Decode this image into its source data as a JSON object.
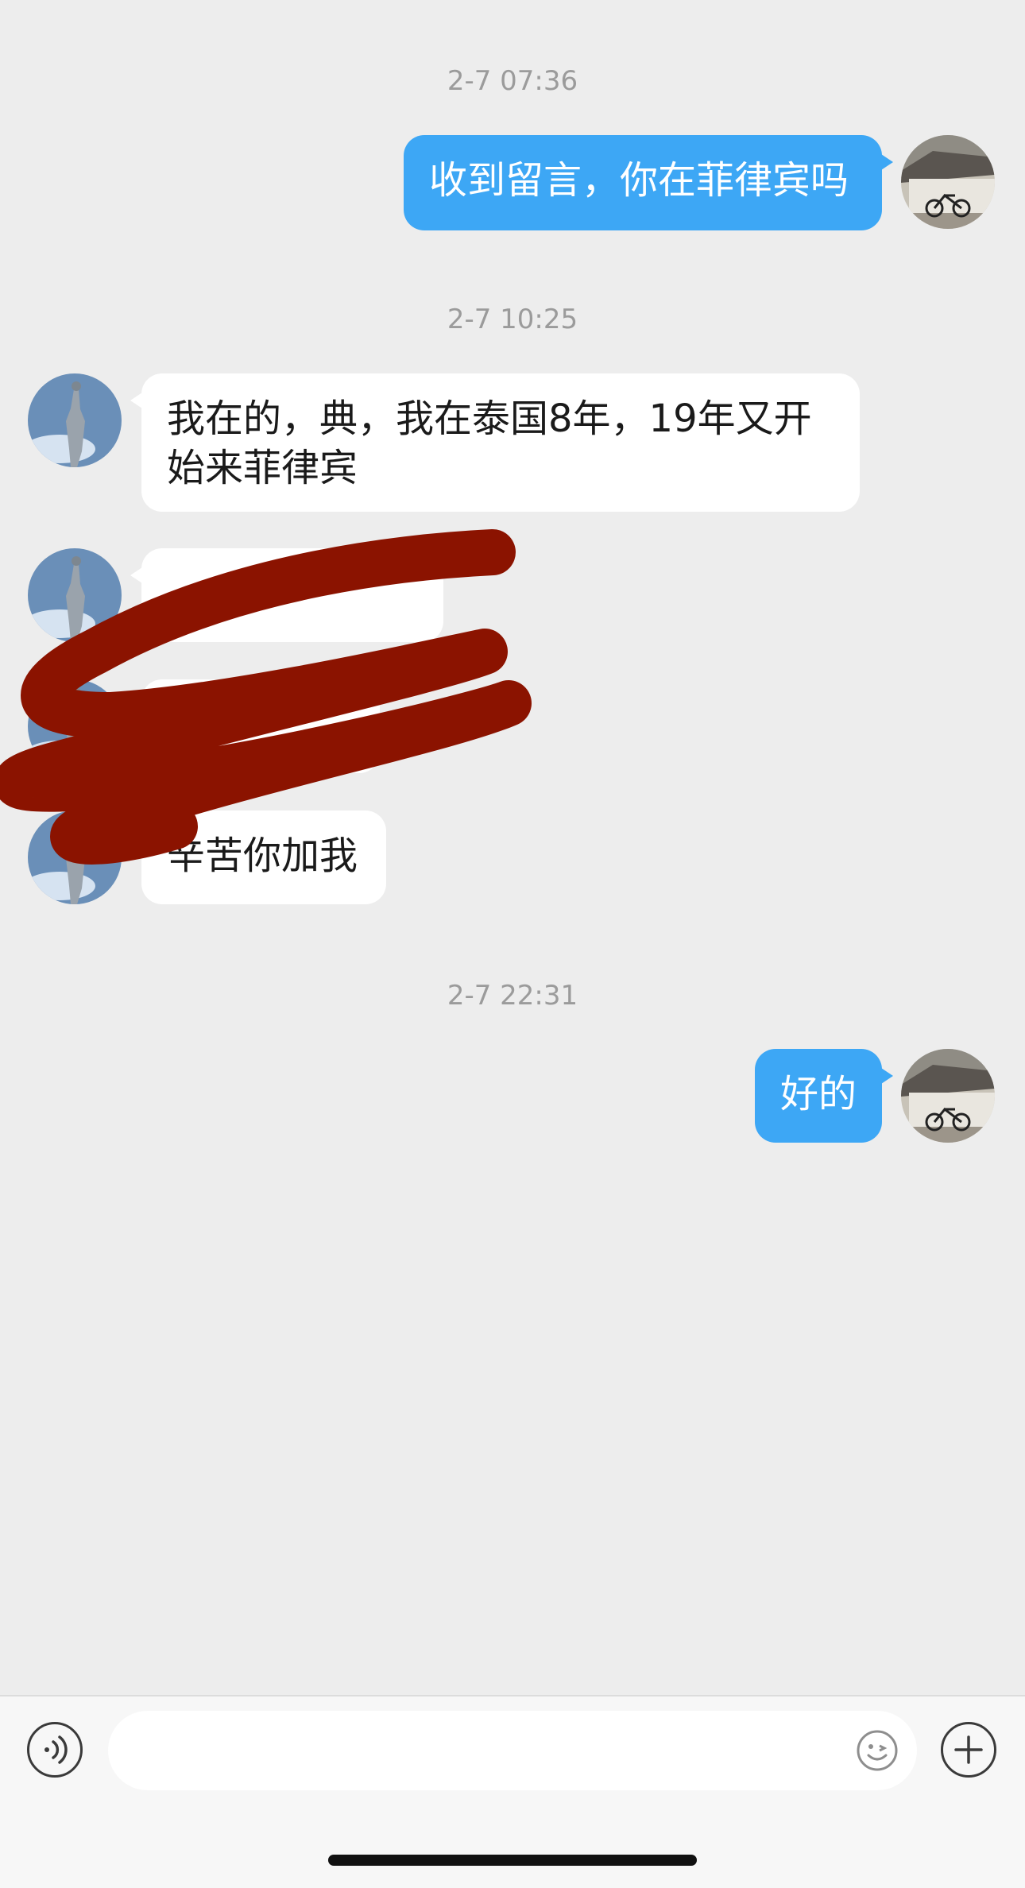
{
  "messages": [
    {
      "timestamp": "2-7 07:36",
      "direction": "outgoing",
      "text": "收到留言，你在菲律宾吗"
    },
    {
      "timestamp": "2-7 10:25",
      "direction": "incoming",
      "text": "我在的，典，我在泰国8年，19年又开始来菲律宾"
    },
    {
      "direction": "incoming",
      "text": "",
      "redacted": true
    },
    {
      "direction": "incoming",
      "text": "",
      "redacted": true
    },
    {
      "direction": "incoming",
      "text": "辛苦你加我"
    },
    {
      "timestamp": "2-7 22:31",
      "direction": "outgoing",
      "text": "好的"
    }
  ],
  "colors": {
    "background": "#ededed",
    "outgoing_bubble": "#3da7f5",
    "incoming_bubble": "#ffffff",
    "redaction": "#8b1300"
  },
  "input_bar": {
    "icons": [
      "voice-icon",
      "emoji-icon",
      "plus-icon"
    ]
  }
}
